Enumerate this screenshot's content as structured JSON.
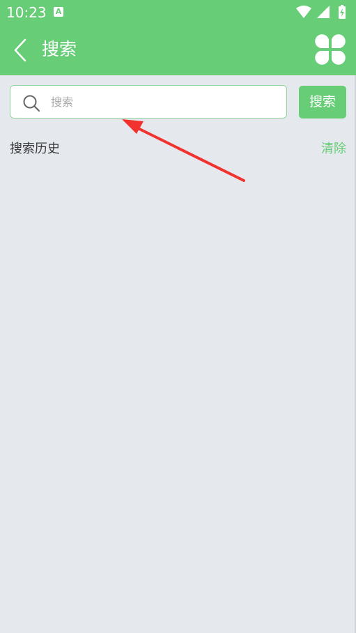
{
  "status_bar": {
    "time": "10:23",
    "notification_letter": "A",
    "icons": [
      "a-notification-icon",
      "wifi-icon",
      "signal-icon",
      "battery-charging-icon"
    ]
  },
  "toolbar": {
    "back_icon": "chevron-left-icon",
    "title": "搜索",
    "menu_icon": "clover-grid-icon"
  },
  "search": {
    "placeholder": "搜索",
    "value": "",
    "icon": "search-icon",
    "button_label": "搜索"
  },
  "history": {
    "title": "搜索历史",
    "clear_label": "清除",
    "items": []
  },
  "colors": {
    "accent": "#67cd77",
    "background": "#e5e9ee",
    "annotation": "#f1322e"
  }
}
